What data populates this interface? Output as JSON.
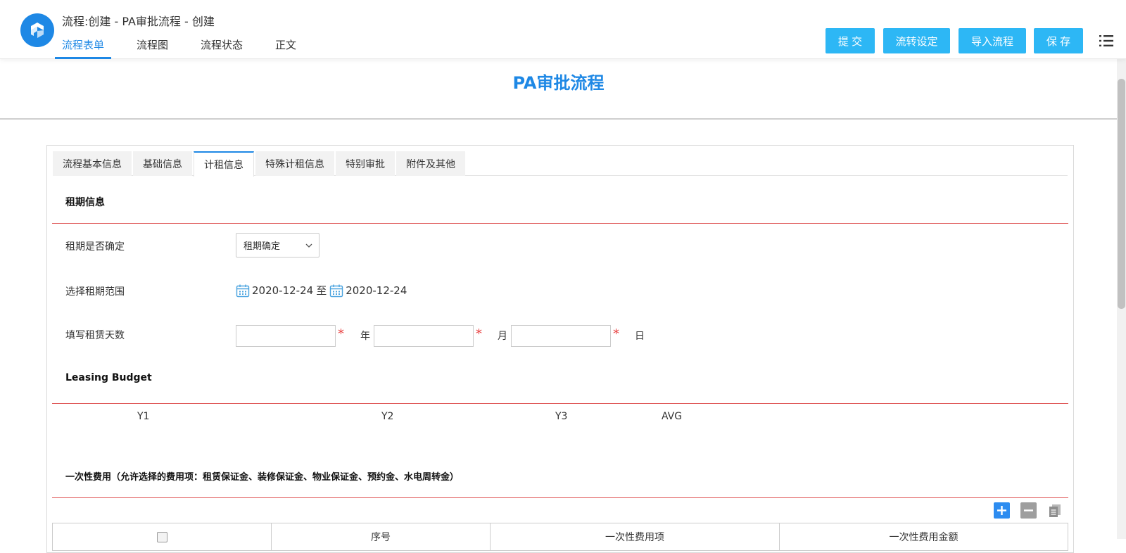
{
  "header": {
    "title": "流程:创建 - PA审批流程 - 创建",
    "tabs": [
      "流程表单",
      "流程图",
      "流程状态",
      "正文"
    ],
    "buttons": {
      "submit": "提 交",
      "routing": "流转设定",
      "import": "导入流程",
      "save": "保 存"
    },
    "accent_color": "#1e88e5",
    "button_color": "#2db7f5"
  },
  "form": {
    "title": "PA审批流程",
    "tabs": [
      "流程基本信息",
      "基础信息",
      "计租信息",
      "特殊计租信息",
      "特别审批",
      "附件及其他"
    ],
    "active_tab": "计租信息"
  },
  "lease": {
    "section_title": "租期信息",
    "determined": {
      "label": "租期是否确定",
      "selected": "租期确定"
    },
    "range": {
      "label": "选择租期范围",
      "start": "2020-12-24",
      "separator": "至",
      "end": "2020-12-24"
    },
    "days": {
      "label": "填写租赁天数",
      "year_unit": "年",
      "month_unit": "月",
      "day_unit": "日",
      "year_value": "",
      "month_value": "",
      "day_value": ""
    }
  },
  "budget": {
    "section_title": "Leasing Budget",
    "columns": [
      "Y1",
      "Y2",
      "Y3",
      "AVG"
    ]
  },
  "one_time": {
    "section_title": "一次性费用（允许选择的费用项：租赁保证金、装修保证金、物业保证金、预约金、水电周转金）",
    "toolbar": [
      "plus-icon",
      "minus-icon",
      "copy-icon"
    ],
    "columns": [
      "",
      "序号",
      "一次性费用项",
      "一次性费用金额"
    ]
  }
}
